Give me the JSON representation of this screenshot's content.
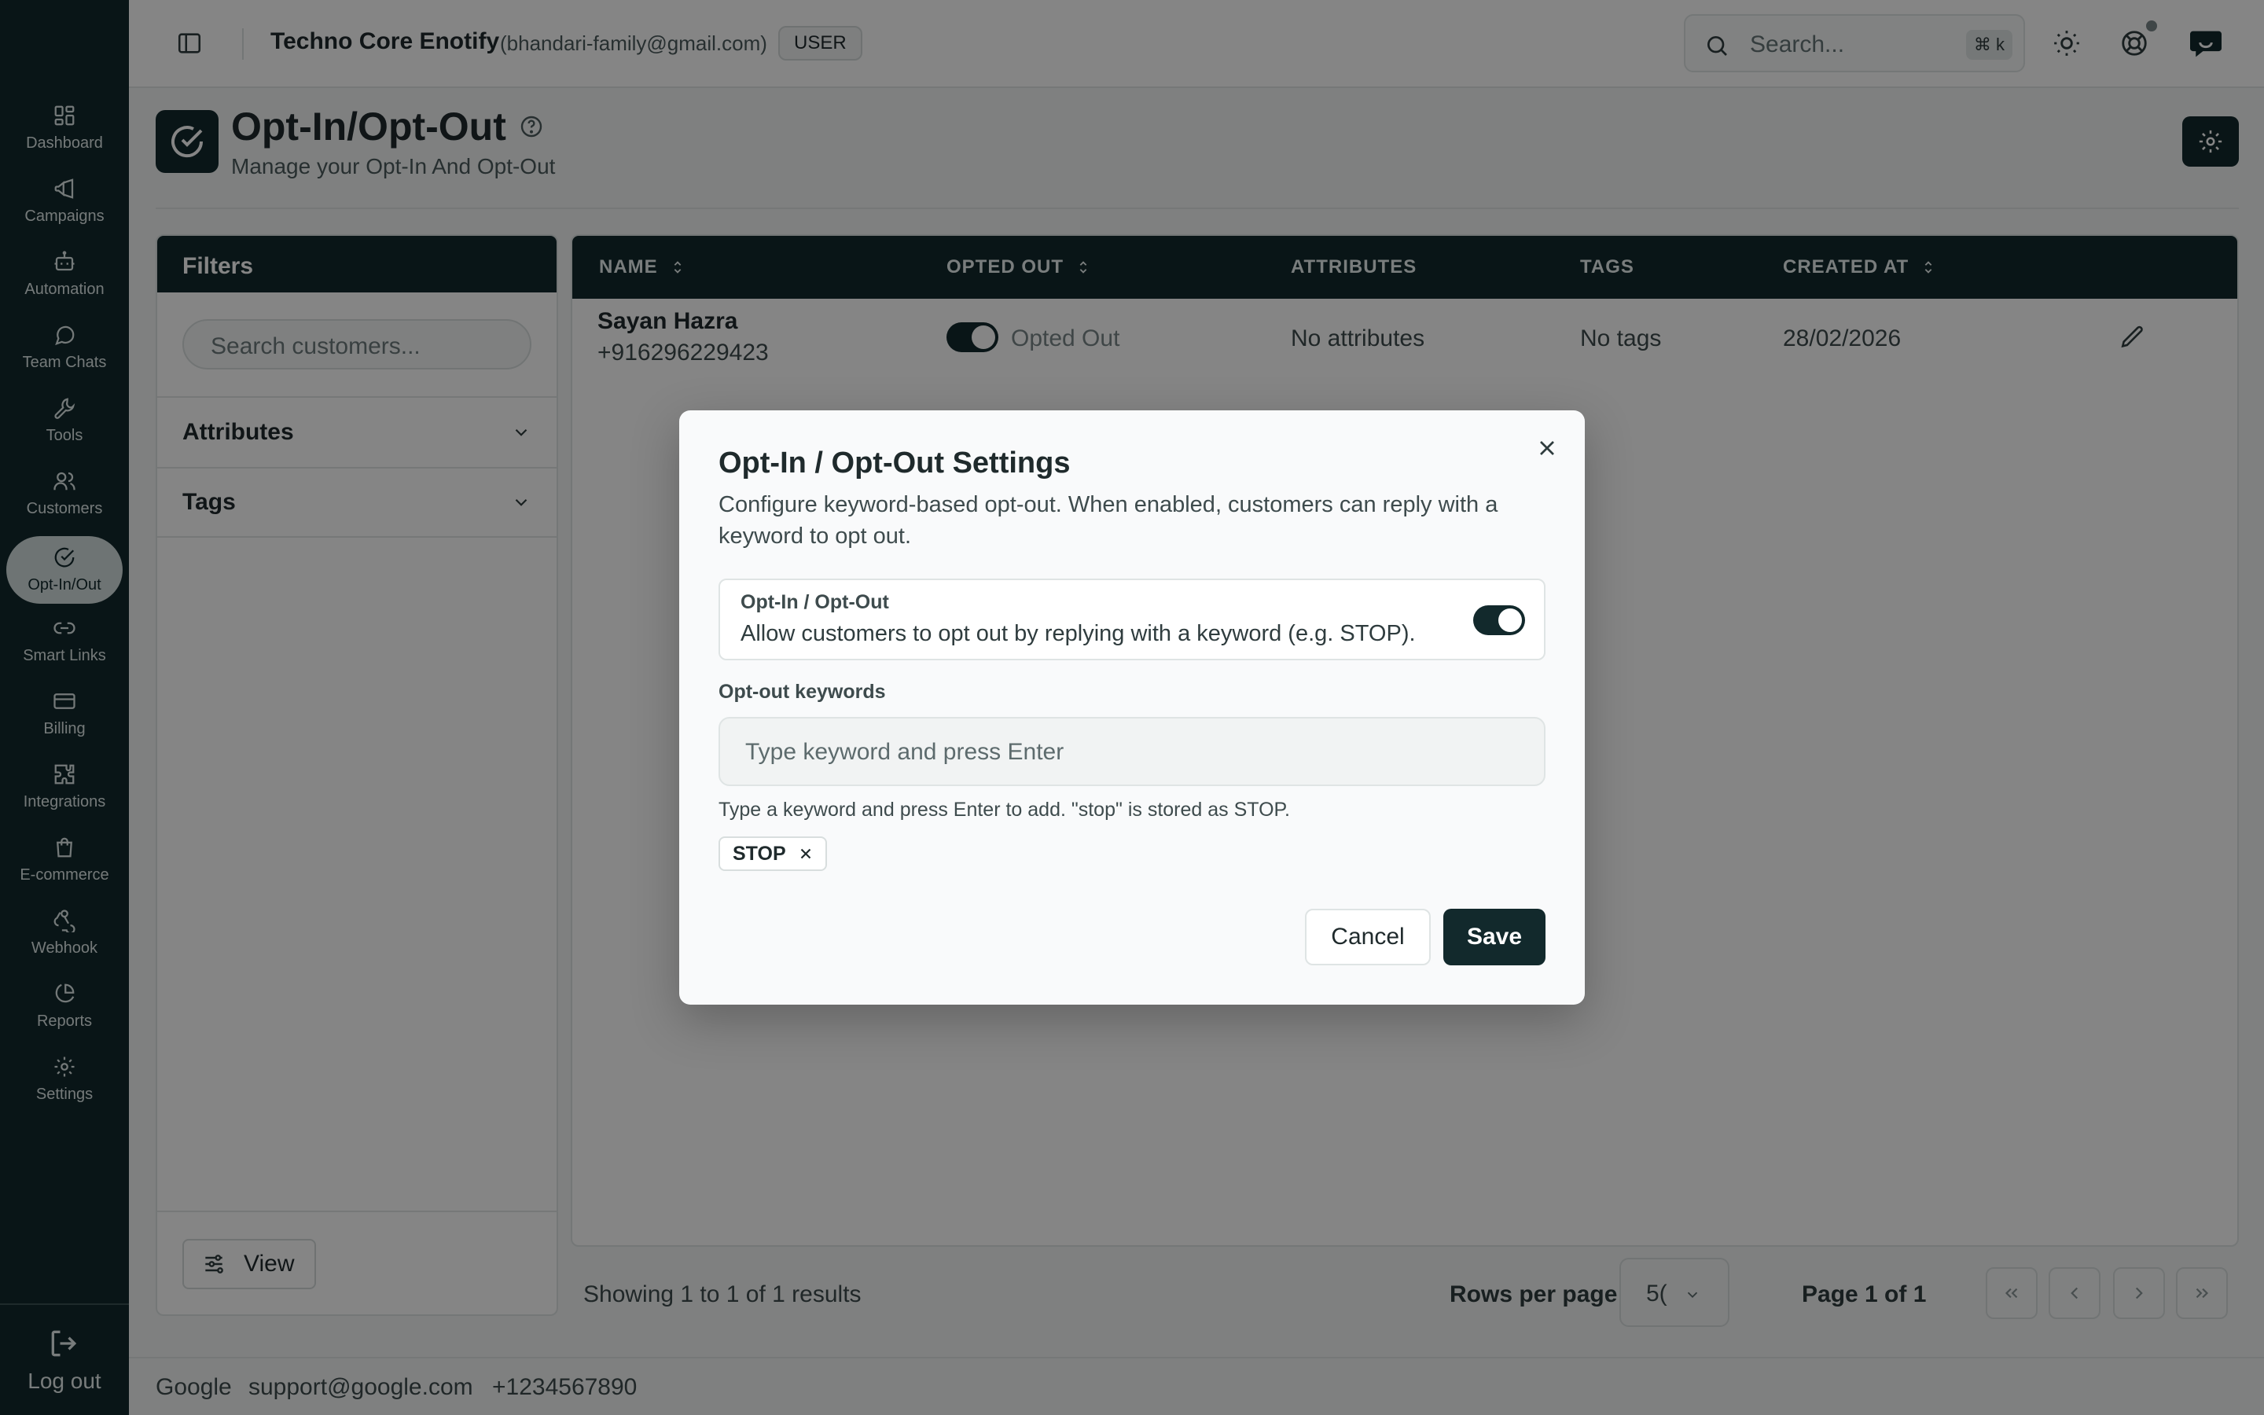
{
  "colors": {
    "primary": "#12292c",
    "overlay": "rgba(0,0,0,0.48)",
    "active_nav_bg": "#d4dede"
  },
  "sidebar": {
    "items": [
      {
        "label": "Dashboard",
        "icon": "grid-icon"
      },
      {
        "label": "Campaigns",
        "icon": "megaphone-icon"
      },
      {
        "label": "Automation",
        "icon": "bot-icon"
      },
      {
        "label": "Team Chats",
        "icon": "chat-bubble-icon"
      },
      {
        "label": "Tools",
        "icon": "wrench-icon"
      },
      {
        "label": "Customers",
        "icon": "users-icon"
      },
      {
        "label": "Opt-In/Out",
        "icon": "check-circle-icon",
        "active": true
      },
      {
        "label": "Smart Links",
        "icon": "link-icon"
      },
      {
        "label": "Billing",
        "icon": "credit-card-icon"
      },
      {
        "label": "Integrations",
        "icon": "puzzle-icon"
      },
      {
        "label": "E-commerce",
        "icon": "shopping-bag-icon"
      },
      {
        "label": "Webhook",
        "icon": "webhook-icon"
      },
      {
        "label": "Reports",
        "icon": "pie-chart-icon"
      },
      {
        "label": "Settings",
        "icon": "gear-icon"
      }
    ],
    "logout_label": "Log out"
  },
  "header": {
    "org_name": "Techno Core Enotify",
    "org_email": "(bhandari-family@gmail.com)",
    "role": "USER",
    "search_placeholder": "Search...",
    "search_shortcut": "⌘ k"
  },
  "page": {
    "title": "Opt-In/Opt-Out",
    "subtitle": "Manage your Opt-In And Opt-Out"
  },
  "filters": {
    "title": "Filters",
    "search_placeholder": "Search customers...",
    "sections": [
      "Attributes",
      "Tags"
    ],
    "view_label": "View"
  },
  "table": {
    "columns": [
      "NAME",
      "OPTED OUT",
      "ATTRIBUTES",
      "TAGS",
      "CREATED AT"
    ],
    "rows": [
      {
        "name": "Sayan Hazra",
        "phone": "+916296229423",
        "opted_out": true,
        "opted_out_label": "Opted Out",
        "attributes": "No attributes",
        "tags": "No tags",
        "created_at": "28/02/2026"
      }
    ],
    "summary": "Showing 1 to 1 of 1 results",
    "rows_per_page_label": "Rows per page",
    "rows_per_page_value": "5(",
    "page_info": "Page 1 of 1"
  },
  "footer": {
    "company": "Google",
    "email": "support@google.com",
    "phone": "+1234567890"
  },
  "modal": {
    "title": "Opt-In / Opt-Out Settings",
    "description": "Configure keyword-based opt-out. When enabled, customers can reply with a keyword to opt out.",
    "setting_label": "Opt-In / Opt-Out",
    "setting_help": "Allow customers to opt out by replying with a keyword (e.g. STOP).",
    "setting_enabled": true,
    "keywords_label": "Opt-out keywords",
    "keywords_placeholder": "Type keyword and press Enter",
    "keywords_help": "Type a keyword and press Enter to add. \"stop\" is stored as STOP.",
    "keywords": [
      "STOP"
    ],
    "cancel_label": "Cancel",
    "save_label": "Save"
  }
}
